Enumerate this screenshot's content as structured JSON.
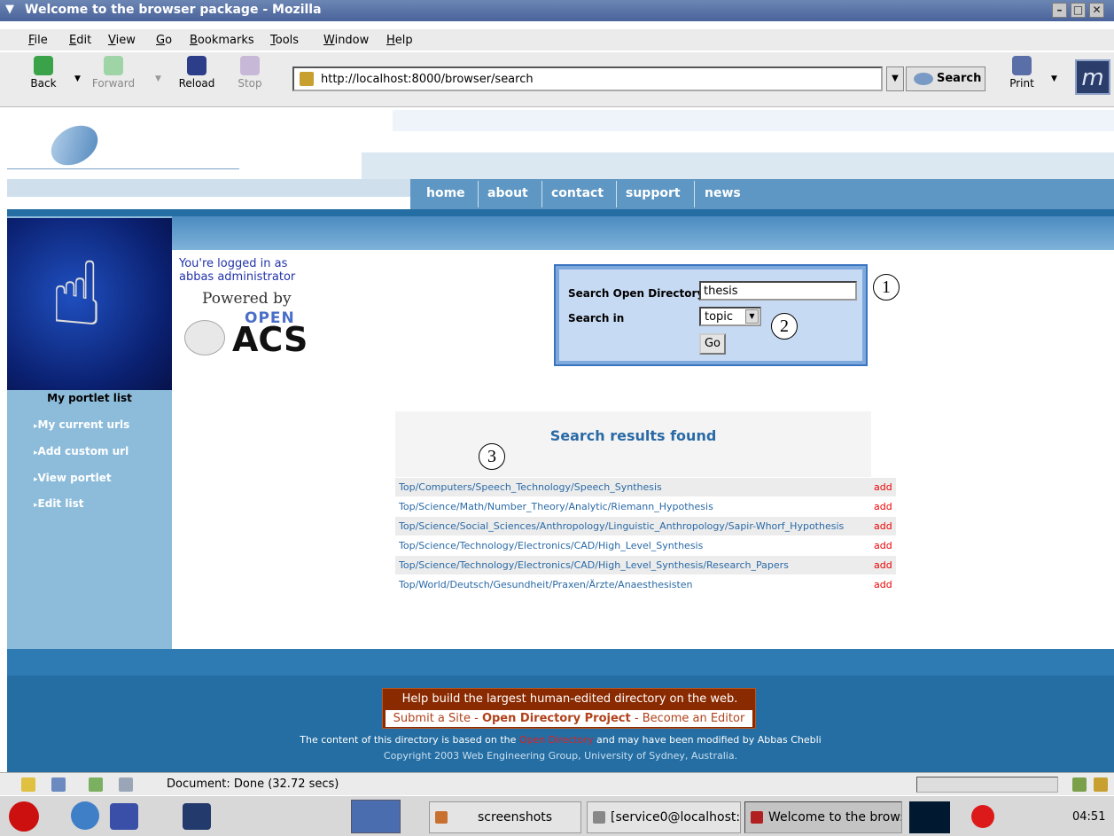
{
  "window": {
    "title": "Welcome to the browser package - Mozilla"
  },
  "menu": [
    "File",
    "Edit",
    "View",
    "Go",
    "Bookmarks",
    "Tools",
    "Window",
    "Help"
  ],
  "toolbar": {
    "back": "Back",
    "forward": "Forward",
    "reload": "Reload",
    "stop": "Stop",
    "print": "Print",
    "search": "Search",
    "mozilla_logo": "m"
  },
  "url": "http://localhost:8000/browser/search",
  "site_nav": [
    "home",
    "about",
    "contact",
    "support",
    "news"
  ],
  "login": "You're logged in as abbas administrator",
  "powered": {
    "line1": "Powered by",
    "open": "OPEN",
    "acs": "ACS"
  },
  "portlet": {
    "title": "My portlet list",
    "items": [
      "My current urls",
      "Add custom url",
      "View portlet",
      "Edit list"
    ]
  },
  "search_form": {
    "label_directory": "Search Open Directory",
    "query": "thesis",
    "label_in": "Search in",
    "scope": "topic",
    "go": "Go"
  },
  "callouts": [
    "1",
    "2",
    "3"
  ],
  "results": {
    "title": "Search results found",
    "add_label": "add",
    "rows": [
      "Top/Computers/Speech_Technology/Speech_Synthesis",
      "Top/Science/Math/Number_Theory/Analytic/Riemann_Hypothesis",
      "Top/Science/Social_Sciences/Anthropology/Linguistic_Anthropology/Sapir-Whorf_Hypothesis",
      "Top/Science/Technology/Electronics/CAD/High_Level_Synthesis",
      "Top/Science/Technology/Electronics/CAD/High_Level_Synthesis/Research_Papers",
      "Top/World/Deutsch/Gesundheit/Praxen/Ärzte/Anaesthesisten"
    ]
  },
  "footer": {
    "odp_headline": "Help build the largest human-edited directory on the web.",
    "submit": "Submit a Site",
    "odp": "Open Directory Project",
    "editor": "Become an Editor",
    "dash": " - ",
    "content_pre": "The content of this directory is based on the ",
    "content_link": "Open Directory",
    "content_post": " and may have been modified by Abbas Chebli",
    "copyright": "Copyright 2003 Web Engineering Group, University of Sydney, Australia."
  },
  "status": "Document: Done (32.72 secs)",
  "taskbar": {
    "items": [
      "screenshots",
      "[service0@localhost:/",
      "Welcome to the brow:"
    ],
    "clock": "04:51"
  },
  "colors": {
    "accent": "#256ea3",
    "link": "#2a6aa6",
    "add": "#ee0000",
    "odp_bg": "#8a2a00"
  }
}
